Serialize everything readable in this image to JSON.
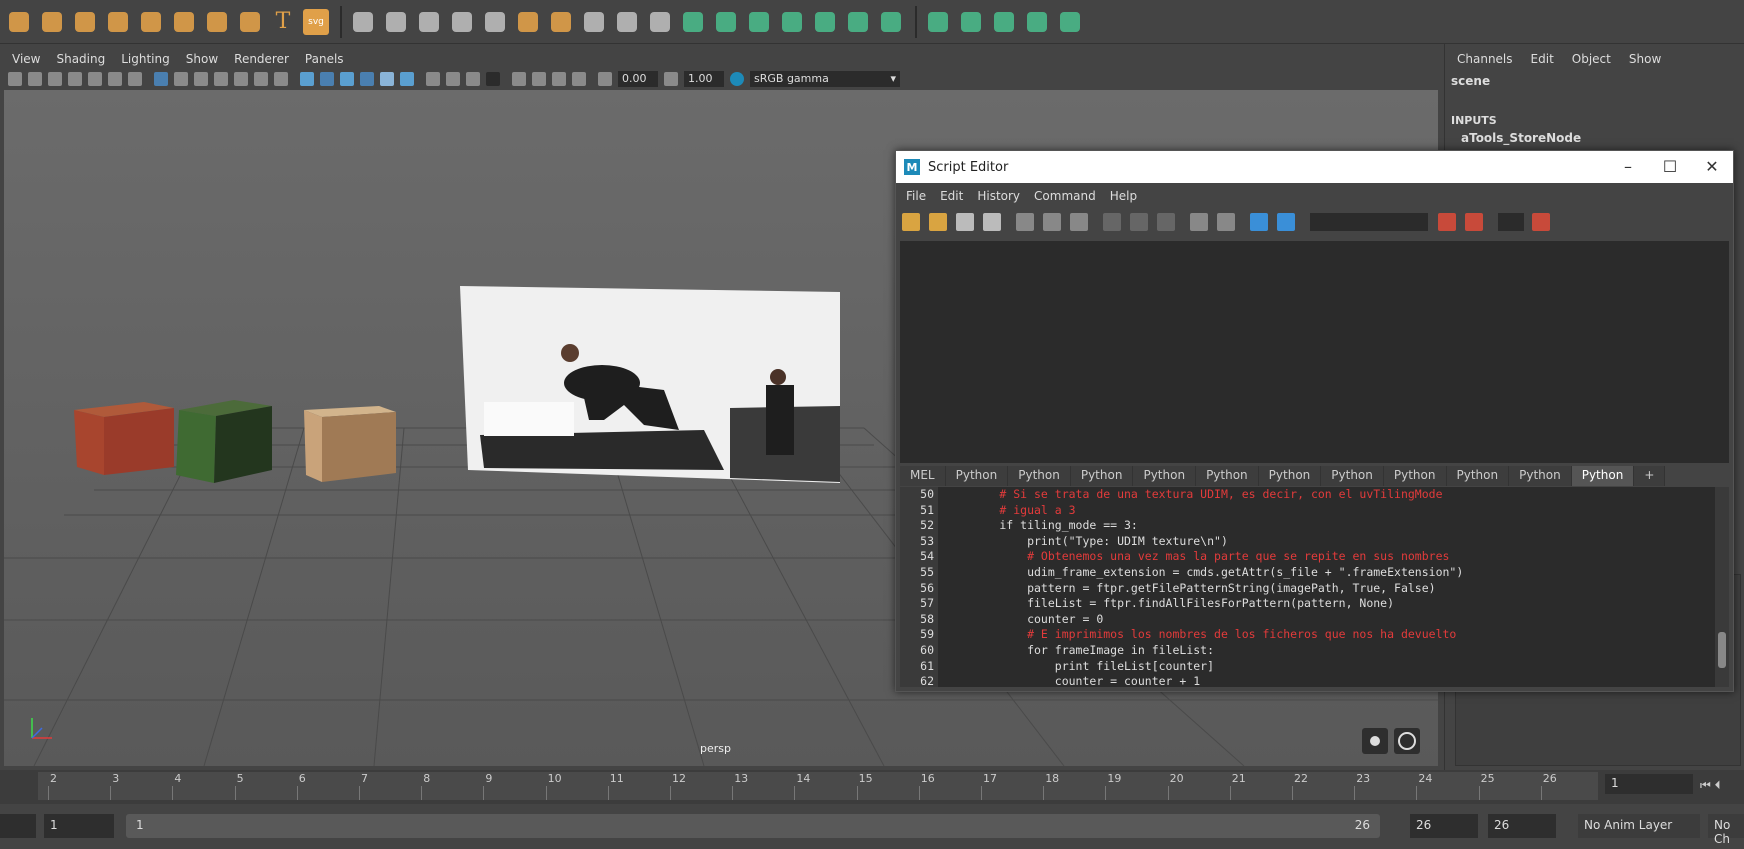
{
  "shelf": {
    "icons": [
      "sphere-icon",
      "cube-icon",
      "cylinder-icon",
      "cone-icon",
      "plane-icon",
      "torus-icon",
      "pyramid-icon",
      "pipe-icon",
      "text-icon",
      "svg-icon",
      "combine-icon",
      "separate-icon",
      "extract-icon",
      "smooth-icon",
      "bevel-icon",
      "bridge-icon",
      "extrude-icon",
      "multicut-icon",
      "target-weld-icon",
      "mirror-icon",
      "uv-planar-icon",
      "uv-auto-icon",
      "uv-unfold-icon",
      "uv-layout-icon",
      "uv-cut-icon",
      "uv-sew-icon",
      "uv-editor-icon",
      "uv-checker-icon",
      "uv-move-icon",
      "uv-stitch-icon",
      "uv-texel-icon",
      "uv-grid-icon"
    ],
    "svg_label": "svg"
  },
  "viewport": {
    "menu": [
      "View",
      "Shading",
      "Lighting",
      "Show",
      "Renderer",
      "Panels"
    ],
    "exposure": "0.00",
    "gamma": "1.00",
    "color_space": "sRGB gamma",
    "camera_label": "persp"
  },
  "channel_box": {
    "menu": [
      "Channels",
      "Edit",
      "Object",
      "Show"
    ],
    "scene": "scene",
    "inputs_header": "INPUTS",
    "input_node": "aTools_StoreNode"
  },
  "timeline": {
    "ticks": [
      "2",
      "3",
      "4",
      "5",
      "6",
      "7",
      "8",
      "9",
      "10",
      "11",
      "12",
      "13",
      "14",
      "15",
      "16",
      "17",
      "18",
      "19",
      "20",
      "21",
      "22",
      "23",
      "24",
      "25",
      "26"
    ],
    "current_frame": "1"
  },
  "range": {
    "start": "1",
    "slider_start": "1",
    "slider_end": "26",
    "end": "26",
    "end2": "26",
    "anim_layer": "No Anim Layer",
    "char_set": "No Ch"
  },
  "script_editor": {
    "title": "Script Editor",
    "menu": [
      "File",
      "Edit",
      "History",
      "Command",
      "Help"
    ],
    "tabs": [
      "MEL",
      "Python",
      "Python",
      "Python",
      "Python",
      "Python",
      "Python",
      "Python",
      "Python",
      "Python",
      "Python",
      "Python",
      "+"
    ],
    "active_tab_index": 11,
    "line_numbers": [
      "50",
      "51",
      "52",
      "53",
      "54",
      "55",
      "56",
      "57",
      "58",
      "59",
      "60",
      "61",
      "62"
    ],
    "code": [
      {
        "text": "        # Si se trata de una textura UDIM, es decir, con el uvTilingMode",
        "kind": "comment"
      },
      {
        "text": "        # igual a 3",
        "kind": "comment"
      },
      {
        "text": "        if tiling_mode == 3:",
        "kind": "default"
      },
      {
        "text": "            print(\"Type: UDIM texture\\n\")",
        "kind": "default"
      },
      {
        "text": "            # Obtenemos una vez mas la parte que se repite en sus nombres",
        "kind": "comment"
      },
      {
        "text": "            udim_frame_extension = cmds.getAttr(s_file + \".frameExtension\")",
        "kind": "default"
      },
      {
        "text": "            pattern = ftpr.getFilePatternString(imagePath, True, False)",
        "kind": "default"
      },
      {
        "text": "            fileList = ftpr.findAllFilesForPattern(pattern, None)",
        "kind": "default"
      },
      {
        "text": "            counter = 0",
        "kind": "default"
      },
      {
        "text": "            # E imprimimos los nombres de los ficheros que nos ha devuelto",
        "kind": "comment"
      },
      {
        "text": "            for frameImage in fileList:",
        "kind": "default"
      },
      {
        "text": "                print fileList[counter]",
        "kind": "default"
      },
      {
        "text": "                counter = counter + 1",
        "kind": "default"
      }
    ]
  },
  "colors": {
    "comment": "#e23b3b",
    "keyword": "#e6d54a",
    "string": "#e6e64a",
    "constant": "#4ae34a",
    "builtin": "#4ab8e6",
    "accent": "#1d8ab8"
  }
}
